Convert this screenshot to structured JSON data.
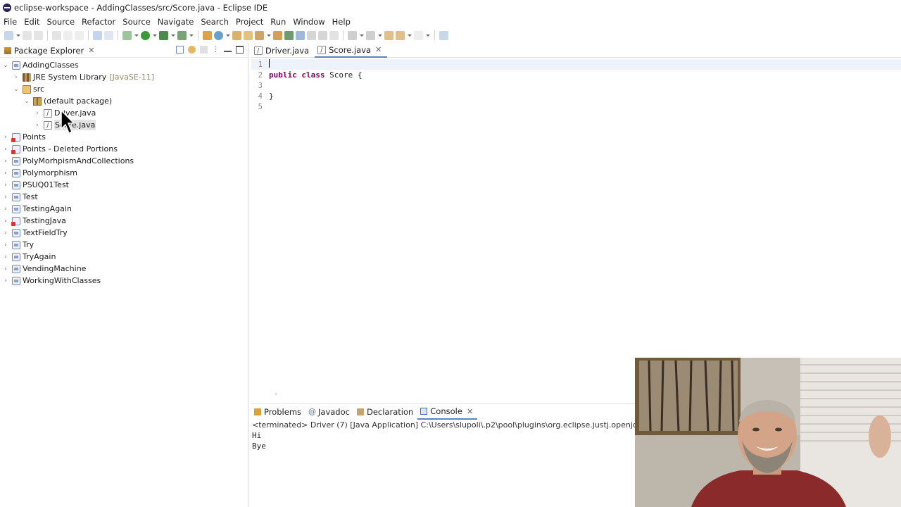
{
  "window": {
    "title": "eclipse-workspace - AddingClasses/src/Score.java - Eclipse IDE"
  },
  "menubar": {
    "items": [
      "File",
      "Edit",
      "Source",
      "Refactor",
      "Source",
      "Navigate",
      "Search",
      "Project",
      "Run",
      "Window",
      "Help"
    ]
  },
  "package_explorer": {
    "title": "Package Explorer",
    "tree": {
      "project": "AddingClasses",
      "jre_label": "JRE System Library",
      "jre_version": "[JavaSE-11]",
      "src": "src",
      "package": "(default package)",
      "files": [
        "Driver.java",
        "Score.java"
      ],
      "other_projects": [
        "Points",
        "Points - Deleted Portions",
        "PolyMorhpismAndCollections",
        "Polymorphism",
        "PSUQ01Test",
        "Test",
        "TestingAgain",
        "TestingJava",
        "TextFieldTry",
        "Try",
        "TryAgain",
        "VendingMachine",
        "WorkingWithClasses"
      ]
    }
  },
  "editor": {
    "tabs": [
      "Driver.java",
      "Score.java"
    ],
    "active_tab": "Score.java",
    "line_numbers": [
      "1",
      "2",
      "3",
      "4",
      "5"
    ],
    "code": {
      "line2_keywords": "public class",
      "line2_rest": " Score {",
      "line4": "}"
    }
  },
  "bottom_panel": {
    "tabs": [
      "Problems",
      "Javadoc",
      "Declaration",
      "Console"
    ],
    "active_tab": "Console",
    "console_status": "<terminated> Driver (7) [Java Application] C:\\Users\\slupoli\\.p2\\pool\\plugins\\org.eclipse.justj.openjdk.hotspot.jre",
    "output": [
      "Hi",
      "Bye"
    ]
  },
  "icons": {
    "accent": "#5b84c4",
    "keyword_color": "#7f0055"
  }
}
